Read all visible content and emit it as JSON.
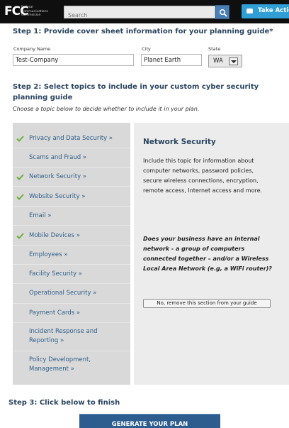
{
  "header": {
    "logo_mark": "FCC",
    "logo_text": "Federal Communications Commission",
    "search_placeholder": "Search",
    "take_action_label": "Take Action"
  },
  "step1": {
    "title": "Step 1: Provide cover sheet information for your planning guide*",
    "company_label": "Company Name",
    "company_value": "Test-Company",
    "city_label": "City",
    "city_value": "Planet Earth",
    "state_label": "State",
    "state_value": "WA"
  },
  "step2": {
    "title": "Step 2: Select topics to include in your custom cyber security planning guide",
    "subtitle": "Choose a topic below to decide whether to include it in your plan.",
    "topics": [
      {
        "label": "Privacy and Data Security »",
        "checked": true
      },
      {
        "label": "Scams and Fraud »",
        "checked": false
      },
      {
        "label": "Network Security »",
        "checked": true
      },
      {
        "label": "Website Security »",
        "checked": true
      },
      {
        "label": "Email »",
        "checked": false
      },
      {
        "label": "Mobile Devices »",
        "checked": true
      },
      {
        "label": "Employees »",
        "checked": false
      },
      {
        "label": "Facility Security »",
        "checked": false
      },
      {
        "label": "Operational Security »",
        "checked": false
      },
      {
        "label": "Payment Cards »",
        "checked": false
      },
      {
        "label": "Incident Response and Reporting »",
        "checked": false
      },
      {
        "label": "Policy Development, Management »",
        "checked": false
      }
    ],
    "detail": {
      "title": "Network Security",
      "body": "Include this topic for information about computer networks, password policies, secure wireless connections, encryption, remote access, Internet access and more.",
      "question": "Does your business have an internal network - a group of computers connected together – and/or a Wireless Local Area Network (e.g, a WiFi router)?",
      "remove_label": "No, remove this section from your guide"
    }
  },
  "step3": {
    "title": "Step 3: Click below to finish",
    "generate_label": "GENERATE YOUR PLAN"
  },
  "colors": {
    "header_bg": "#0f0f0f",
    "heading": "#2b4561",
    "link": "#2f5f8a",
    "check": "#6fae3a",
    "take_action": "#2f9fd6",
    "generate_bg": "#2c5d8e",
    "topic_list_bg": "#d9d9d9",
    "detail_bg": "#ececec"
  }
}
